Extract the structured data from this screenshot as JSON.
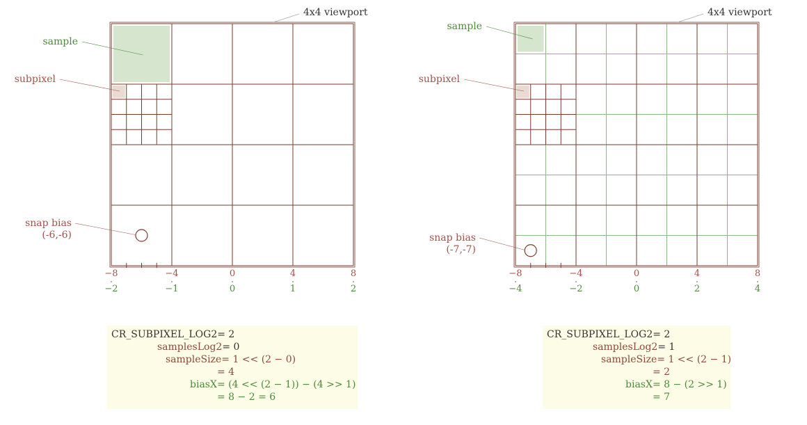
{
  "colors": {
    "grid_brown": "#7a3b2e",
    "grid_green": "#8fb88a",
    "sample_fill": "#d6e5ce",
    "subpixel_fill": "#eadbd2",
    "label_green": "#4a8a3a",
    "label_brown": "#a0524a",
    "callout_grey": "#aaaaaa",
    "eq_background": "#fdfce6"
  },
  "panels": [
    {
      "viewport_label": "4x4 viewport",
      "sample_label": "sample",
      "subpixel_label": "subpixel",
      "snap_bias_label": "snap bias",
      "snap_bias_value": "(-6,-6)",
      "samples_per_axis": 4,
      "subpixel_axis": {
        "ticks": [
          "−8",
          "−4",
          "0",
          "4",
          "8"
        ],
        "minor_tick_values": [
          -7,
          -6,
          -5
        ]
      },
      "sample_axis": {
        "ticks": [
          "−2",
          "−1",
          "0",
          "1",
          "2"
        ]
      },
      "snap_bias_point": [
        -6,
        -6
      ],
      "equations": {
        "line1_label": "CR_SUBPIXEL_LOG2",
        "line1_value": "= 2",
        "line2_label": "samplesLog2",
        "line2_value": "= 0",
        "line3_label": "sampleSize",
        "line3_value": "= 1 << (2 − 0)",
        "line4_value": "= 4",
        "line5_label": "biasX",
        "line5_value": "= (4 << (2 − 1)) − (4 >> 1)",
        "line6_value": "= 8 − 2 = 6"
      }
    },
    {
      "viewport_label": "4x4 viewport",
      "sample_label": "sample",
      "subpixel_label": "subpixel",
      "snap_bias_label": "snap bias",
      "snap_bias_value": "(-7,-7)",
      "samples_per_axis": 8,
      "subpixel_axis": {
        "ticks": [
          "−8",
          "−4",
          "0",
          "4",
          "8"
        ],
        "minor_tick_values": [
          -7,
          -6,
          -5
        ]
      },
      "sample_axis": {
        "ticks": [
          "−4",
          "−2",
          "0",
          "2",
          "4"
        ]
      },
      "snap_bias_point": [
        -7,
        -7
      ],
      "equations": {
        "line1_label": "CR_SUBPIXEL_LOG2",
        "line1_value": "= 2",
        "line2_label": "samplesLog2",
        "line2_value": "= 1",
        "line3_label": "sampleSize",
        "line3_value": "= 1 << (2 − 1)",
        "line4_value": "= 2",
        "line5_label": "biasX",
        "line5_value": "= 8 − (2 >> 1)",
        "line6_value": "= 7"
      }
    }
  ]
}
